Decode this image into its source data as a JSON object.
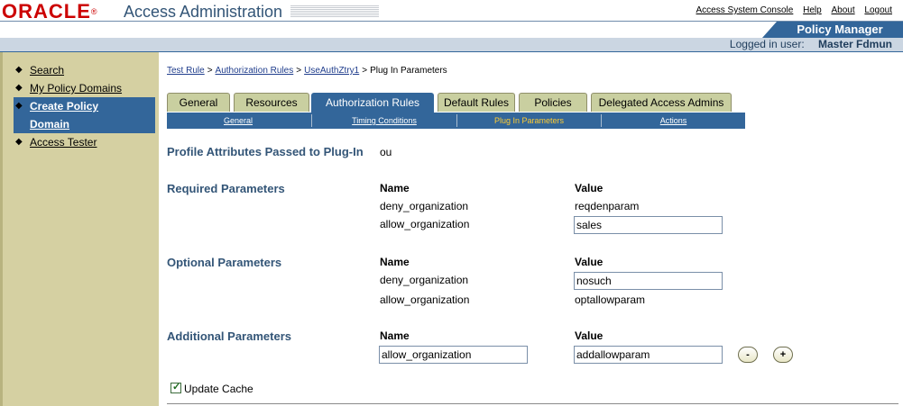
{
  "header": {
    "logo": "ORACLE",
    "app_title": "Access Administration",
    "links": [
      "Access System Console",
      "Help",
      "About",
      "Logout"
    ],
    "product_tab": "Policy Manager",
    "logged_in_prefix": "Logged in user: ",
    "logged_in_user": "Master Fdmun"
  },
  "sidebar": {
    "items": [
      "Search",
      "My Policy Domains",
      "Create Policy",
      "Domain",
      "Access Tester"
    ]
  },
  "breadcrumb": {
    "items": [
      "Test Rule",
      "Authorization Rules",
      "UseAuthZtry1"
    ],
    "current": "Plug In Parameters",
    "sep": ">"
  },
  "tabs": [
    "General",
    "Resources",
    "Authorization Rules",
    "Default Rules",
    "Policies",
    "Delegated Access Admins"
  ],
  "subtabs": [
    "General",
    "Timing Conditions",
    "Plug In Parameters",
    "Actions"
  ],
  "profile": {
    "label": "Profile Attributes Passed to Plug-In",
    "value": "ou"
  },
  "required": {
    "label": "Required Parameters",
    "name_header": "Name",
    "value_header": "Value",
    "rows": [
      {
        "name": "deny_organization",
        "value": "reqdenparam"
      },
      {
        "name": "allow_organization",
        "value": "sales"
      }
    ]
  },
  "optional": {
    "label": "Optional Parameters",
    "name_header": "Name",
    "value_header": "Value",
    "rows": [
      {
        "name": "deny_organization",
        "value": "nosuch"
      },
      {
        "name": "allow_organization",
        "value": "optallowparam"
      }
    ]
  },
  "additional": {
    "label": "Additional Parameters",
    "name_header": "Name",
    "value_header": "Value",
    "name_value": "allow_organization",
    "value_value": "addallowparam",
    "remove_label": "-",
    "add_label": "+"
  },
  "update_cache": {
    "label": "Update Cache",
    "checked": true
  },
  "colors": {
    "accent": "#33669a",
    "sidebar": "#d5d0a2",
    "tab": "#c9cfa0",
    "label": "#335577",
    "active_subtab": "#ffcc33"
  }
}
